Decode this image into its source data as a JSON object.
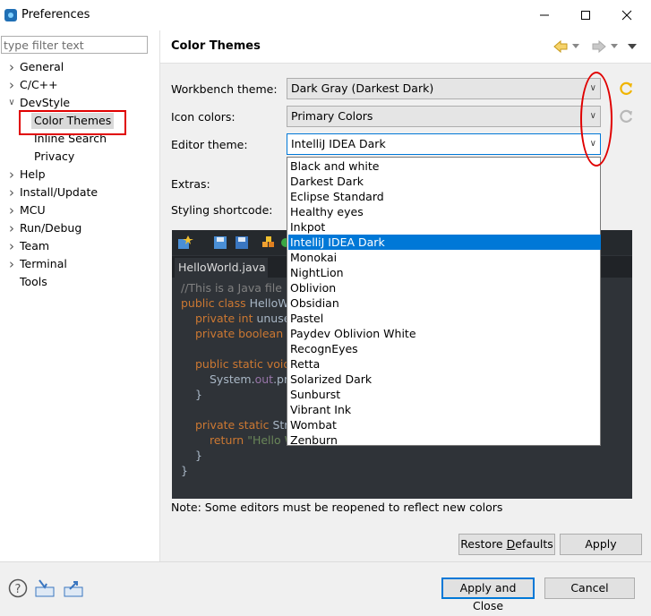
{
  "window": {
    "title": "Preferences"
  },
  "left": {
    "filter_placeholder": "type filter text",
    "tree": [
      {
        "label": "General",
        "expandable": true
      },
      {
        "label": "C/C++",
        "expandable": true
      },
      {
        "label": "DevStyle",
        "expandable": true,
        "expanded": true
      },
      {
        "label": "Color Themes",
        "child": true,
        "selected": true
      },
      {
        "label": "Inline Search",
        "child": true
      },
      {
        "label": "Privacy",
        "child": true
      },
      {
        "label": "Help",
        "expandable": true
      },
      {
        "label": "Install/Update",
        "expandable": true
      },
      {
        "label": "MCU",
        "expandable": true
      },
      {
        "label": "Run/Debug",
        "expandable": true
      },
      {
        "label": "Team",
        "expandable": true
      },
      {
        "label": "Terminal",
        "expandable": true
      },
      {
        "label": "Tools",
        "expandable": false
      }
    ]
  },
  "main": {
    "title": "Color Themes",
    "workbench_label": "Workbench theme:",
    "workbench_value": "Dark Gray (Darkest Dark)",
    "icon_label": "Icon colors:",
    "icon_value": "Primary Colors",
    "editor_label": "Editor theme:",
    "editor_value": "IntelliJ IDEA Dark",
    "extras_label": "Extras:",
    "shortcode_label": "Styling shortcode:",
    "theme_options": [
      "Black and white",
      "Darkest Dark",
      "Eclipse Standard",
      "Healthy eyes",
      "Inkpot",
      "IntelliJ IDEA Dark",
      "Monokai",
      "NightLion",
      "Oblivion",
      "Obsidian",
      "Pastel",
      "Paydev Oblivion White",
      "RecognEyes",
      "Retta",
      "Solarized Dark",
      "Sunburst",
      "Vibrant Ink",
      "Wombat",
      "Zenburn"
    ],
    "selected_option": "IntelliJ IDEA Dark",
    "preview": {
      "tab": "HelloWorld.java",
      "lines": [
        {
          "text": "//This is a Java file",
          "color": "#808080",
          "indent": 0
        },
        {
          "parts": [
            [
              "public class ",
              "#cc7832"
            ],
            [
              "HelloWo",
              "#a9b7c6"
            ]
          ],
          "indent": 0
        },
        {
          "parts": [
            [
              "private int ",
              "#cc7832"
            ],
            [
              "unused",
              "#a9b7c6"
            ]
          ],
          "indent": 1
        },
        {
          "parts": [
            [
              "private boolean ",
              "#cc7832"
            ],
            [
              "u",
              "#a9b7c6"
            ]
          ],
          "indent": 1
        },
        {
          "parts": [],
          "indent": 0
        },
        {
          "parts": [
            [
              "public static void ",
              "#cc7832"
            ]
          ],
          "indent": 1
        },
        {
          "parts": [
            [
              "System.",
              "#a9b7c6"
            ],
            [
              "out",
              "#9876aa"
            ],
            [
              ".prin",
              "#a9b7c6"
            ]
          ],
          "indent": 2
        },
        {
          "parts": [
            [
              "}",
              "#a9b7c6"
            ]
          ],
          "indent": 1
        },
        {
          "parts": [],
          "indent": 0
        },
        {
          "parts": [
            [
              "private static ",
              "#cc7832"
            ],
            [
              "Strin",
              "#a9b7c6"
            ]
          ],
          "indent": 1
        },
        {
          "parts": [
            [
              "return ",
              "#cc7832"
            ],
            [
              "\"Hello W",
              "#6a8759"
            ]
          ],
          "indent": 2
        },
        {
          "parts": [
            [
              "}",
              "#a9b7c6"
            ]
          ],
          "indent": 1
        },
        {
          "parts": [
            [
              "}",
              "#a9b7c6"
            ]
          ],
          "indent": 0
        }
      ]
    },
    "note": "Note: Some editors must be reopened to reflect new colors",
    "restore_label": "Restore Defaults",
    "restore_mnemonic": "D",
    "apply_label": "Apply"
  },
  "footer": {
    "apply_close_label": "Apply and Close",
    "cancel_label": "Cancel"
  },
  "colors": {
    "selection": "#0078d7",
    "annotation": "#e00000",
    "accent_yellow": "#f0b400"
  }
}
